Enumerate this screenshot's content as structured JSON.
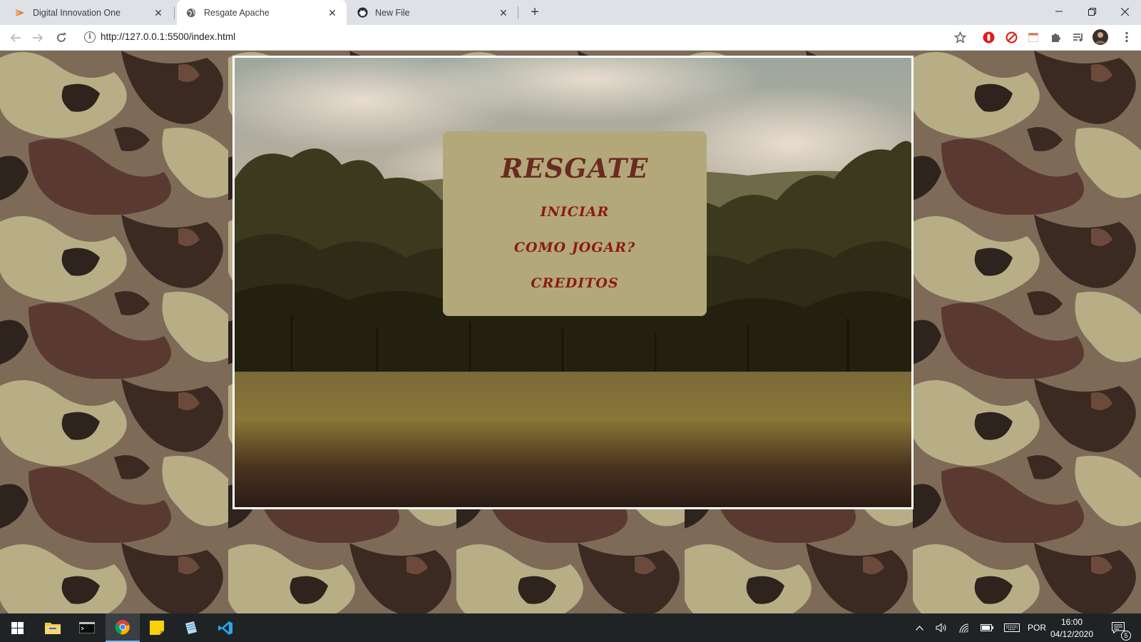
{
  "browser": {
    "tabs": [
      {
        "title": "Digital Innovation One",
        "favicon": "dio-icon",
        "active": false
      },
      {
        "title": "Resgate Apache",
        "favicon": "globe-icon",
        "active": true
      },
      {
        "title": "New File",
        "favicon": "github-icon",
        "active": false
      }
    ],
    "new_tab_label": "+",
    "url": "http://127.0.0.1:5500/index.html"
  },
  "game": {
    "title": "RESGATE",
    "menu": [
      {
        "label": "INICIAR"
      },
      {
        "label": "COMO JOGAR?"
      },
      {
        "label": "CREDITOS"
      }
    ],
    "colors": {
      "menu_box": "#b3a87a",
      "title": "#6a2a22",
      "menu_text": "#8b1a14",
      "frame_border": "#ffffff"
    }
  },
  "taskbar": {
    "apps": [
      "windows-start-icon",
      "file-explorer-icon",
      "terminal-icon",
      "chrome-icon",
      "sticky-notes-icon",
      "notepad-icon",
      "vscode-icon"
    ],
    "language": "POR",
    "time": "16:00",
    "date": "04/12/2020",
    "notification_count": "5"
  }
}
